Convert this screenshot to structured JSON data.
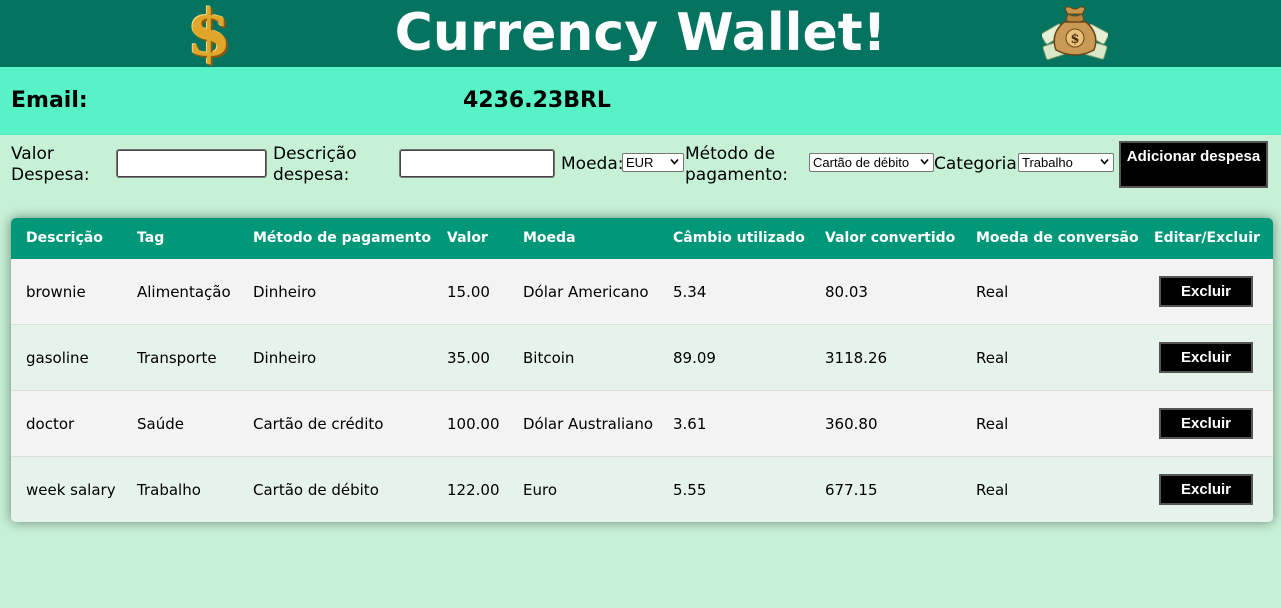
{
  "header": {
    "title": "Currency Wallet!",
    "dollar_icon_glyph": "$",
    "left_icon": "dollar-sign-icon",
    "right_icon": "money-bag-icon",
    "background": "#04735f"
  },
  "info": {
    "email_label": "Email:",
    "total": "4236.23BRL",
    "background": "#57f2c6"
  },
  "form": {
    "value_label": "Valor Despesa:",
    "description_label": "Descrição despesa:",
    "currency_label": "Moeda:",
    "currency_value": "EUR",
    "method_label": "Método de pagamento:",
    "method_value": "Cartão de débito",
    "category_label": "Categoria:",
    "category_value": "Trabalho",
    "add_button": "Adicionar despesa"
  },
  "table": {
    "headers": [
      "Descrição",
      "Tag",
      "Método de pagamento",
      "Valor",
      "Moeda",
      "Câmbio utilizado",
      "Valor convertido",
      "Moeda de conversão",
      "Editar/Excluir"
    ],
    "header_color": "#009879",
    "rows": [
      {
        "descricao": "brownie",
        "tag": "Alimentação",
        "metodo": "Dinheiro",
        "valor": "15.00",
        "moeda": "Dólar Americano",
        "cambio": "5.34",
        "convertido": "80.03",
        "moeda_conversao": "Real",
        "action": "Excluir"
      },
      {
        "descricao": "gasoline",
        "tag": "Transporte",
        "metodo": "Dinheiro",
        "valor": "35.00",
        "moeda": "Bitcoin",
        "cambio": "89.09",
        "convertido": "3118.26",
        "moeda_conversao": "Real",
        "action": "Excluir"
      },
      {
        "descricao": "doctor",
        "tag": "Saúde",
        "metodo": "Cartão de crédito",
        "valor": "100.00",
        "moeda": "Dólar Australiano",
        "cambio": "3.61",
        "convertido": "360.80",
        "moeda_conversao": "Real",
        "action": "Excluir"
      },
      {
        "descricao": "week salary",
        "tag": "Trabalho",
        "metodo": "Cartão de débito",
        "valor": "122.00",
        "moeda": "Euro",
        "cambio": "5.55",
        "convertido": "677.15",
        "moeda_conversao": "Real",
        "action": "Excluir"
      }
    ]
  }
}
